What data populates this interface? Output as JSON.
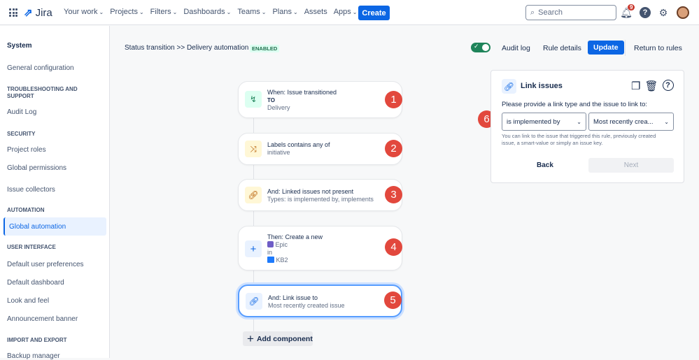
{
  "header": {
    "app": "Jira",
    "nav": [
      "Your work",
      "Projects",
      "Filters",
      "Dashboards",
      "Teams",
      "Plans",
      "Assets",
      "Apps"
    ],
    "nav_dropdown": [
      true,
      true,
      true,
      true,
      true,
      true,
      false,
      true
    ],
    "create": "Create",
    "search_placeholder": "Search",
    "notifications": "9"
  },
  "sidebar": {
    "title": "System",
    "items": [
      {
        "type": "item",
        "label": "General configuration"
      },
      {
        "type": "heading",
        "label": "Troubleshooting and support"
      },
      {
        "type": "item",
        "label": "Audit Log"
      },
      {
        "type": "heading",
        "label": "Security"
      },
      {
        "type": "item",
        "label": "Project roles"
      },
      {
        "type": "item",
        "label": "Global permissions"
      },
      {
        "type": "item",
        "label": "Issue collectors"
      },
      {
        "type": "heading",
        "label": "Automation"
      },
      {
        "type": "item",
        "label": "Global automation",
        "selected": true
      },
      {
        "type": "heading",
        "label": "User interface"
      },
      {
        "type": "item",
        "label": "Default user preferences"
      },
      {
        "type": "item",
        "label": "Default dashboard"
      },
      {
        "type": "item",
        "label": "Look and feel"
      },
      {
        "type": "item",
        "label": "Announcement banner"
      },
      {
        "type": "heading",
        "label": "Import and export"
      },
      {
        "type": "item",
        "label": "Backup manager"
      }
    ]
  },
  "rule": {
    "breadcrumb": "Status transition >> Delivery automation",
    "status": "ENABLED",
    "enabled": true,
    "audit_log": "Audit log",
    "rule_details": "Rule details",
    "update": "Update",
    "return": "Return to rules"
  },
  "components": [
    {
      "n": "1",
      "line1": "When: Issue transitioned",
      "line2": "TO",
      "line3": "Delivery"
    },
    {
      "n": "2",
      "line1": "Labels contains any of",
      "line2": "initiative"
    },
    {
      "n": "3",
      "line1": "And: Linked issues not present",
      "line2": "Types: is implemented by, implements"
    },
    {
      "n": "4",
      "line1": "Then: Create a new",
      "line2": "Epic",
      "line3": "in",
      "line4": "KB2"
    },
    {
      "n": "5",
      "line1": "And: Link issue to",
      "line2": "Most recently created issue"
    }
  ],
  "add_component": "Add component",
  "panel": {
    "title": "Link issues",
    "prompt": "Please provide a link type and the issue to link to:",
    "link_type": "is implemented by",
    "issue": "Most recently crea...",
    "help": "You can link to the issue that triggered this rule, previously created issue, a smart-value or simply an issue key.",
    "back": "Back",
    "next": "Next",
    "marker": "6"
  }
}
